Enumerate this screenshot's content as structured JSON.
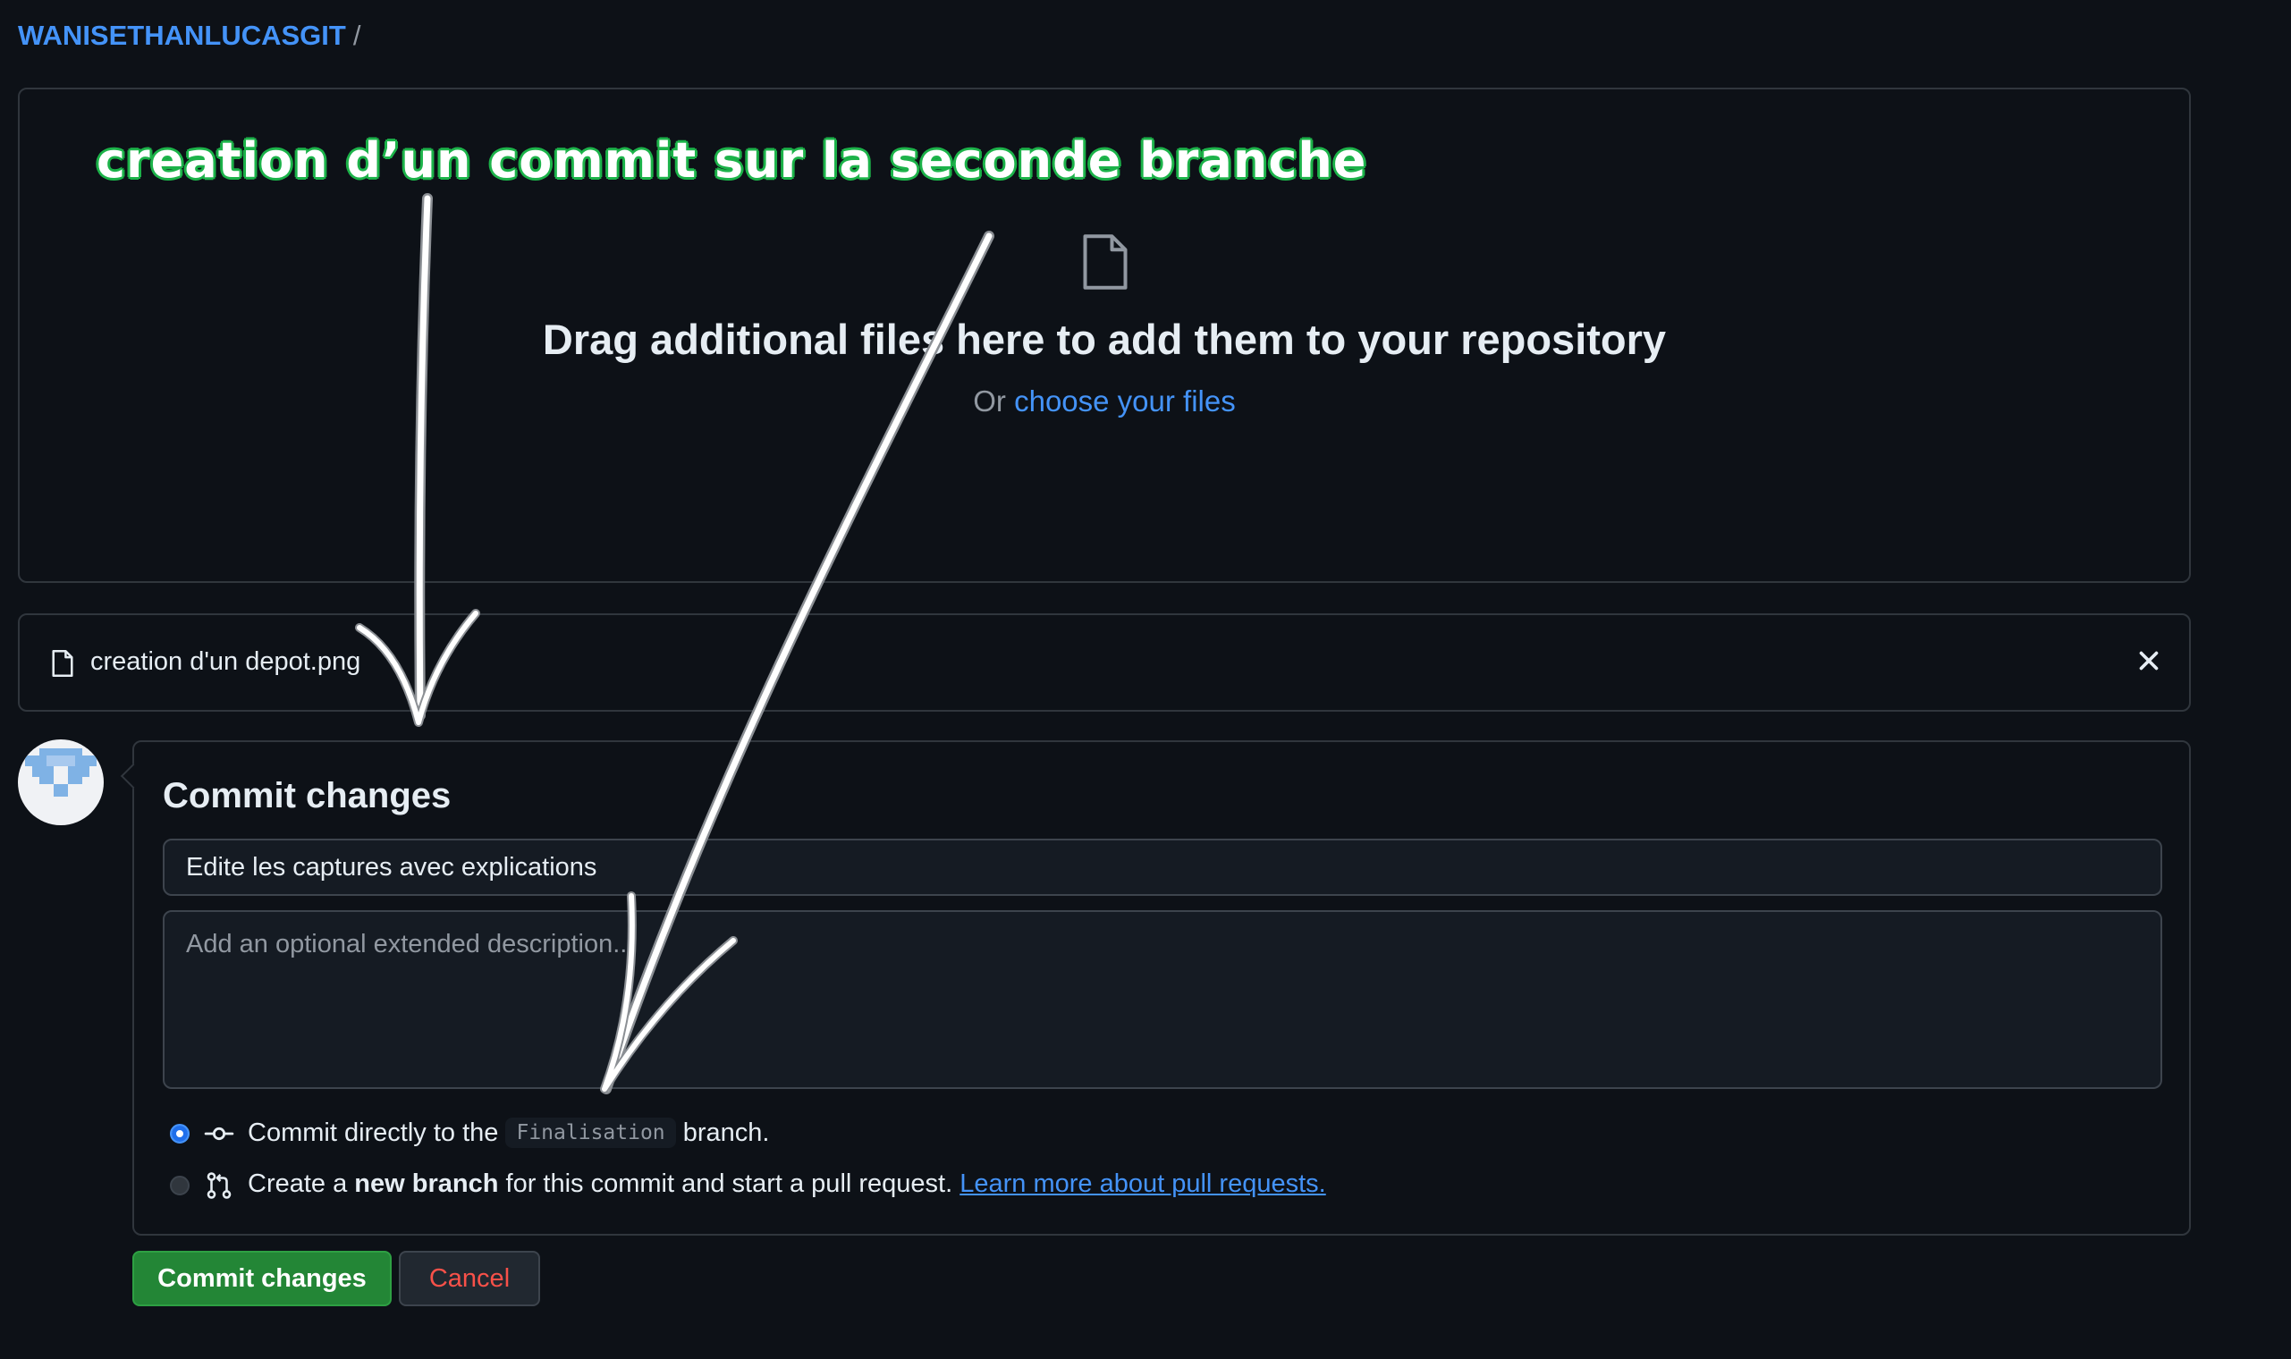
{
  "breadcrumb": {
    "owner": "WANISETHANLUCASGIT",
    "separator": "/"
  },
  "annotation": {
    "title": "creation d’un commit sur la seconde branche"
  },
  "dropzone": {
    "title": "Drag additional files here to add them to your repository",
    "or_text": "Or ",
    "choose_link": "choose your files"
  },
  "file": {
    "name": "creation d'un depot.png"
  },
  "commit": {
    "title": "Commit changes",
    "summary_value": "Edite les captures avec explications",
    "description_placeholder": "Add an optional extended description...",
    "option_direct": {
      "prefix": "Commit directly to the",
      "branch": "Finalisation",
      "suffix": "branch.",
      "selected": true
    },
    "option_new": {
      "prefix": "Create a ",
      "bold": "new branch",
      "middle": " for this commit and start a pull request. ",
      "link": "Learn more about pull requests.",
      "selected": false
    },
    "commit_button": "Commit changes",
    "cancel_button": "Cancel"
  },
  "colors": {
    "accent_link": "#4493f8",
    "primary_button": "#238636",
    "danger_text": "#f85149",
    "annotation_outline": "#1db34a"
  },
  "icons": [
    "file-icon",
    "close-icon",
    "git-commit-icon",
    "git-pull-request-icon",
    "avatar"
  ]
}
